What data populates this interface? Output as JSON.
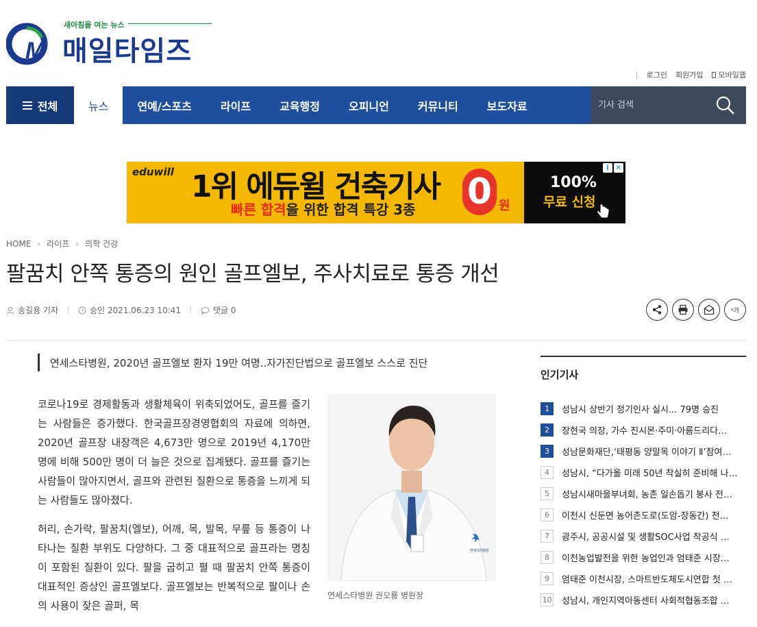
{
  "logo": {
    "tagline": "새아침을 여는 뉴스",
    "name": "매일타임즈"
  },
  "util_links": [
    "로그인",
    "회원가입",
    "모바일웹"
  ],
  "nav": {
    "all_label": "전체",
    "items": [
      "뉴스",
      "연예/스포츠",
      "라이프",
      "교육행정",
      "오피니언",
      "커뮤니티",
      "보도자료"
    ],
    "search_placeholder": "기사 검색"
  },
  "ad": {
    "brand": "eduwill",
    "headline": "1위 에듀윌 건축기사",
    "sub_red1": "빠른 합격",
    "sub_mid": "을 위한 ",
    "sub_bold": "합격 특강 3종",
    "zero": "0",
    "won": "원",
    "percent": "100%",
    "free": "무료 신청"
  },
  "breadcrumb": [
    "HOME",
    "라이프",
    "의학 건강"
  ],
  "article": {
    "title": "팔꿈치 안쪽 통증의 원인 골프엘보, 주사치료로 통증 개선",
    "author": "송길용 기자",
    "approved": "승인 2021.06.23 10:41",
    "comments": "댓글 0",
    "font_btn": "가",
    "subtitle": "연세스타병원, 2020년 골프엘보 환자 19만 여명..자가진단법으로 골프엘보 스스로 진단",
    "paragraphs": [
      "코로나19로 경제활동과 생활체육이 위축되었어도, 골프를 즐기는 사람들은 증가했다. 한국골프장경영협회의 자료에 의하면, 2020년 골프장 내장객은 4,673만 명으로 2019년 4,170만 명에 비해 500만 명이 더 늘은 것으로 집계됐다. 골프를 즐기는 사람들이 많아지면서, 골프와 관련된 질환으로 통증을 느끼게 되는 사람들도 많아졌다.",
      "허리, 손가락, 팔꿈치(엘보), 어깨, 목, 발목, 무릎 등 통증이 나타나는 질환 부위도 다양하다. 그 중 대표적으로 골프라는 명칭이 포함된 질환이 있다. 팔을 굽히고 펼 때 팔꿈치 안쪽 통증이 대표적인 증상인 골프엘보다. 골프엘보는 반복적으로 팔이나 손의 사용이 잦은 골퍼, 목"
    ],
    "photo_caption": "연세스타병원 권오룡 병원장",
    "photo_badge": "연세스타병원"
  },
  "popular": {
    "heading": "인기기사",
    "items": [
      "성남시 상반기 정기인사 실시... 79명 승진",
      "장현국 의장, 가수 진시몬·주미·아름드리다…",
      "성남문화재단,‘태평동 양말목 이야기 Ⅱ’참여…",
      "성남시, “다가올 미래 50년 착실히 준비해 나…",
      "성남시새마을부녀회, 농촌 일손돕기 봉사 전…",
      "이천시 신둔면 농어촌도로(도암-장동간) 전…",
      "광주시, 공공시설 및 생활SOC사업 착공식 …",
      "이천농업발전을 위한 농업인과 엄태준 시장…",
      "엄태준 이천시장, 스마트반도체도시연합 첫 …",
      "성남시, 개인지역아동센터 사회적협동조합 …"
    ]
  }
}
